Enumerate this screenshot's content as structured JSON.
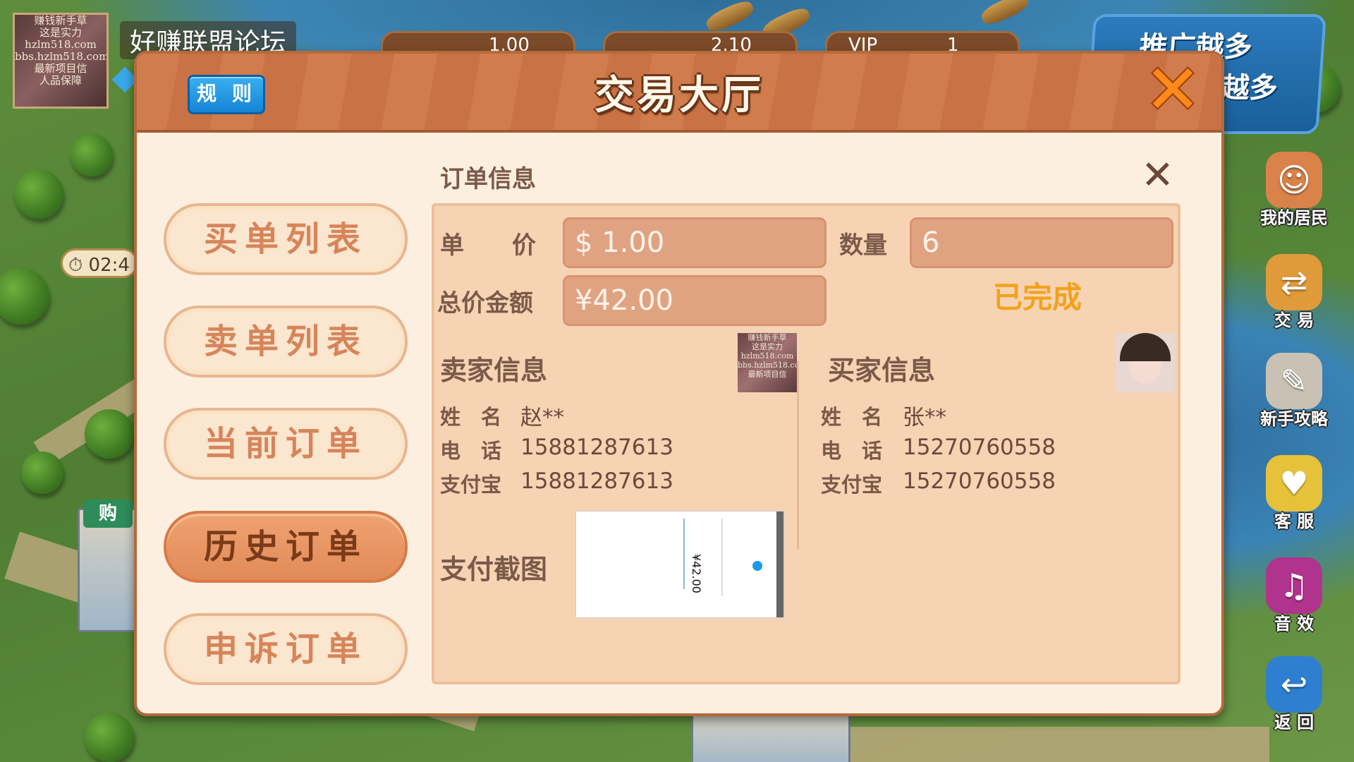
{
  "forum": {
    "name": "好赚联盟论坛",
    "avatar_text": [
      "赚钱新手草",
      "这是实力",
      "hzlm518.com",
      "bbs.hzlm518.com",
      "最新项目信",
      "人品保障"
    ]
  },
  "hud": {
    "stat1": "1.00",
    "stat2": "2.10",
    "stat3_label": "VIP",
    "stat3": "1",
    "timer": "02:4",
    "building_sign": "购",
    "promo": [
      "推广越多",
      "越多"
    ]
  },
  "side_menu": [
    {
      "label": "我的居民",
      "icon": "residents-icon"
    },
    {
      "label": "交 易",
      "icon": "exchange-icon"
    },
    {
      "label": "新手攻略",
      "icon": "guide-icon"
    },
    {
      "label": "客 服",
      "icon": "service-icon"
    },
    {
      "label": "音 效",
      "icon": "music-icon"
    },
    {
      "label": "返 回",
      "icon": "back-icon"
    }
  ],
  "dialog": {
    "title": "交易大厅",
    "rules_label": "规 则"
  },
  "nav": {
    "items": [
      {
        "label": "买单列表"
      },
      {
        "label": "卖单列表"
      },
      {
        "label": "当前订单"
      },
      {
        "label": "历史订单",
        "active": true
      },
      {
        "label": "申诉订单"
      }
    ]
  },
  "order": {
    "title": "订单信息",
    "unit_price_label": "单　　价",
    "unit_price": "$ 1.00",
    "quantity_label": "数量",
    "quantity": "6",
    "total_label": "总价金额",
    "total": "¥42.00",
    "status": "已完成",
    "seller": {
      "title": "卖家信息",
      "name_key": "姓　名",
      "name": "赵**",
      "phone_key": "电　话",
      "phone": "15881287613",
      "alipay_key": "支付宝",
      "alipay": "15881287613",
      "avatar_text": [
        "赚钱新手草",
        "这是实力",
        "hzlm518.com",
        "bbs.hzlm518.com",
        "最新项目信"
      ]
    },
    "buyer": {
      "title": "买家信息",
      "name_key": "姓　名",
      "name": "张**",
      "phone_key": "电　话",
      "phone": "15270760558",
      "alipay_key": "支付宝",
      "alipay": "15270760558"
    },
    "screenshot_label": "支付截图",
    "screenshot_amount": "¥42.00"
  }
}
